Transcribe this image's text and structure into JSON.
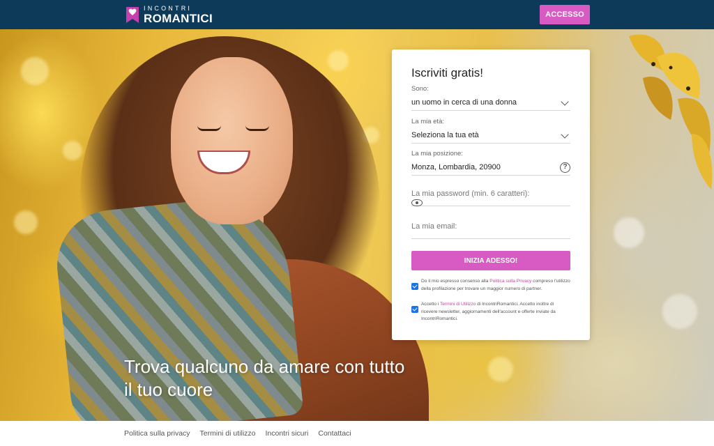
{
  "header": {
    "logo_top": "INCONTRI",
    "logo_bottom": "ROMANTICI",
    "login_label": "ACCESSO"
  },
  "hero": {
    "headline": "Trova qualcuno da amare con tutto il tuo cuore"
  },
  "signup": {
    "title": "Iscriviti gratis!",
    "fields": [
      {
        "label": "Sono:",
        "value": "un uomo in cerca di una donna",
        "icon": "chevron-down-icon"
      },
      {
        "label": "La mia età:",
        "value": "Seleziona la tua età",
        "icon": "chevron-down-icon"
      },
      {
        "label": "La mia posizione:",
        "value": "Monza, Lombardia, 20900",
        "icon": "help-circle-icon"
      },
      {
        "placeholder": "La mia password (min. 6 caratteri):",
        "icon": "eye-icon"
      },
      {
        "placeholder": "La mia email:"
      }
    ],
    "submit_label": "INIZIA ADESSO!",
    "consent1": {
      "before": "Do il mio espresso consenso alla ",
      "link": "Politica sulla Privacy",
      "after": " compreso l'utilizzo della profilazione per trovare un maggior numero di partner.",
      "checked": true
    },
    "consent2": {
      "before": "Accetto i ",
      "link": "Termini di Utilizzo",
      "after": " di IncontriRomantici. Accetto inoltre di ricevere newsletter, aggiornamenti dell'account e offerte inviate da IncontriRomantici.",
      "checked": true
    }
  },
  "footer": {
    "links": [
      "Politica sulla privacy",
      "Termini di utilizzo",
      "Incontri sicuri",
      "Contattaci"
    ]
  },
  "colors": {
    "header_bg": "#0e3a5a",
    "accent": "#d85bc3",
    "checkbox": "#1a73e8"
  }
}
